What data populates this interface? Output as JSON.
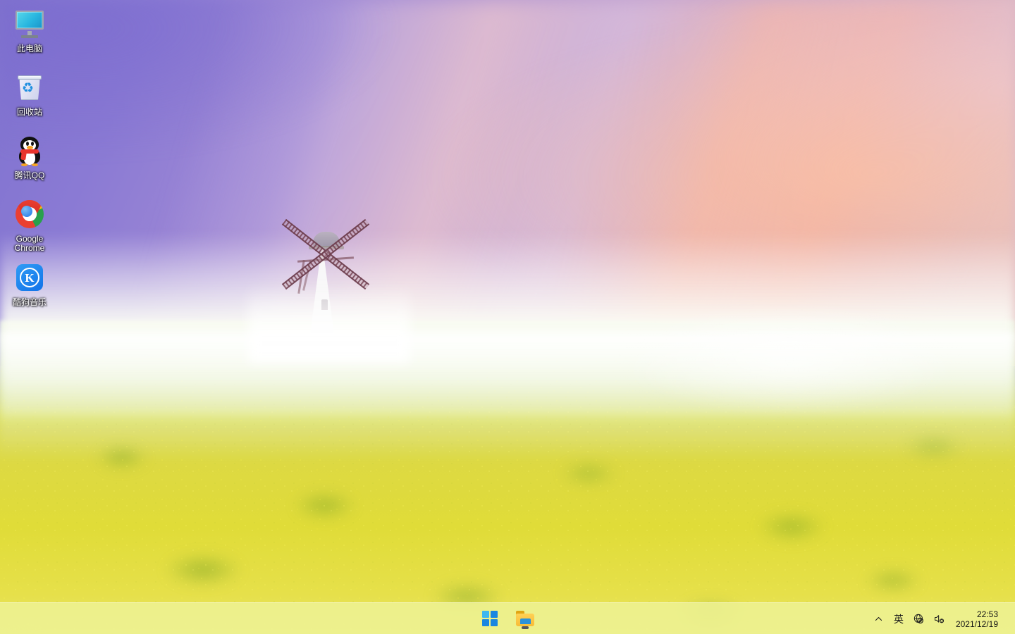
{
  "desktop": {
    "wallpaper": {
      "description": "Windmill in misty rapeseed flower field at sunset",
      "sky_top_color": "#7f72cf",
      "sky_bottom_color": "#e3bfc2",
      "field_color": "#ddd942",
      "mist_color": "#fcfdf6"
    },
    "icons": [
      {
        "id": "this-pc",
        "label": "此电脑",
        "icon": "monitor-icon"
      },
      {
        "id": "recycle-bin",
        "label": "回收站",
        "icon": "recycle-bin-icon"
      },
      {
        "id": "tencent-qq",
        "label": "腾讯QQ",
        "icon": "qq-penguin-icon"
      },
      {
        "id": "google-chrome",
        "label": "Google Chrome",
        "icon": "chrome-icon"
      },
      {
        "id": "kugou-music",
        "label": "酷狗音乐",
        "icon": "kugou-icon",
        "glyph": "K"
      }
    ]
  },
  "taskbar": {
    "background_color": "#eef396",
    "buttons": [
      {
        "id": "start",
        "label": "开始",
        "icon": "windows-logo-icon",
        "running": false
      },
      {
        "id": "file-explorer",
        "label": "文件资源管理器",
        "icon": "folder-icon",
        "running": true
      }
    ],
    "tray": {
      "overflow": {
        "label": "显示隐藏的图标",
        "icon": "chevron-up-icon"
      },
      "ime": {
        "label": "英",
        "icon": "ime-icon"
      },
      "network": {
        "label": "未连接网络",
        "icon": "globe-disconnected-icon"
      },
      "volume": {
        "label": "未安装音频设备",
        "icon": "speaker-muted-icon"
      }
    },
    "clock": {
      "time": "22:53",
      "date": "2021/12/19"
    }
  }
}
